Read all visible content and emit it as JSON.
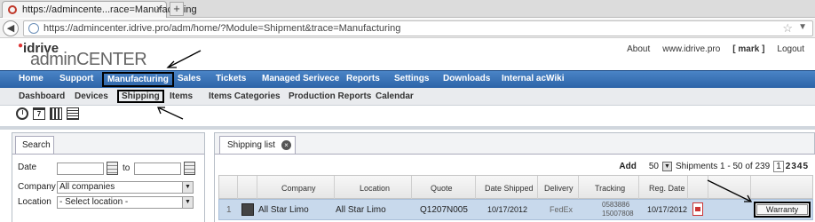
{
  "browser": {
    "tab_title": "https://admincente...race=Manufacturing",
    "url": "https://admincenter.idrive.pro/adm/home/?Module=Shipment&trace=Manufacturing"
  },
  "header": {
    "logo_brand": "idrive",
    "logo_product": "adminCENTER",
    "links": [
      "About",
      "www.idrive.pro",
      "[ mark ]",
      "Logout"
    ]
  },
  "main_nav": [
    "Home",
    "Support",
    "Manufacturing",
    "Sales",
    "Tickets",
    "Managed Serivece",
    "Reports",
    "Settings",
    "Downloads",
    "Internal acWiki"
  ],
  "sub_nav": [
    "Dashboard",
    "Devices",
    "Shipping",
    "Items",
    "Items Categories",
    "Production Reports",
    "Calendar"
  ],
  "calendar_icon_day": "7",
  "search": {
    "tab_label": "Search",
    "date_label": "Date",
    "to_label": "to",
    "company_label": "Company",
    "company_value": "All companies",
    "location_label": "Location",
    "location_value": "- Select location -"
  },
  "shipping": {
    "tab_label": "Shipping list",
    "add_label": "Add",
    "page_size": "50",
    "range_text": "Shipments 1 - 50 of 239",
    "pages": [
      "1",
      "2",
      "3",
      "4",
      "5"
    ],
    "columns": [
      "Company",
      "Location",
      "Quote",
      "Date Shipped",
      "Delivery",
      "Tracking",
      "Reg. Date"
    ],
    "row": {
      "num": "1",
      "company": "All Star Limo",
      "location": "All Star Limo",
      "quote": "Q1207N005",
      "date_shipped": "10/17/2012",
      "delivery": "FedEx",
      "tracking1": "0583886",
      "tracking2": "15007808",
      "reg_date": "10/17/2012",
      "warranty_label": "Warranty"
    }
  }
}
